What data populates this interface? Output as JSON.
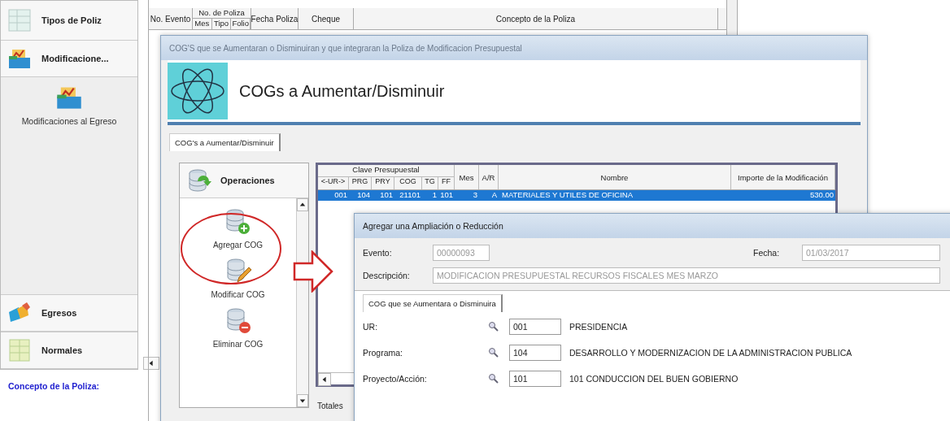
{
  "nav": {
    "items": [
      {
        "label": "Tipos de Poliz"
      },
      {
        "label": "Modificacione..."
      }
    ],
    "sub_item": {
      "label": "Modificaciones al Egreso"
    },
    "bottom_items": [
      {
        "label": "Egresos"
      },
      {
        "label": "Normales"
      }
    ]
  },
  "concept": {
    "label": "Concepto de la Poliza:"
  },
  "polizas_table": {
    "columns": [
      {
        "label": "No. Evento"
      },
      {
        "label": "No. de Poliza",
        "sub": [
          "Mes",
          "Tipo",
          "Folio"
        ]
      },
      {
        "label": "Fecha Poliza"
      },
      {
        "label": "Cheque"
      },
      {
        "label": "Concepto de la Poliza"
      }
    ]
  },
  "cogs_window": {
    "title": "COG'S que se Aumentaran o Disminuiran y que integraran la Poliza de Modificacion Presupuestal",
    "heading": "COGs a Aumentar/Disminuir",
    "tabs": [
      {
        "label": "COG's a Aumentar/Disminuir",
        "selected": true
      }
    ],
    "operations": {
      "title": "Operaciones",
      "items": [
        {
          "label": "Agregar COG"
        },
        {
          "label": "Modificar COG"
        },
        {
          "label": "Eliminar COG"
        }
      ]
    },
    "table": {
      "group": "Clave Presupuestal",
      "columns": [
        "<-UR->",
        "PRG",
        "PRY",
        "COG",
        "TG",
        "FF",
        "Mes",
        "A/R",
        "Nombre",
        "Importe de la Modificación"
      ],
      "rows": [
        {
          "cells": [
            "001",
            "104",
            "101",
            "21101",
            "1",
            "101",
            "3",
            "A",
            "MATERIALES Y UTILES DE OFICINA",
            "530.00"
          ],
          "selected": true
        }
      ]
    },
    "totals_label": "Totales"
  },
  "add_window": {
    "title": "Agregar una Ampliación o Reducción",
    "evento": {
      "label": "Evento:",
      "value": "00000093",
      "disabled": true
    },
    "fecha": {
      "label": "Fecha:",
      "value": "01/03/2017",
      "disabled": true
    },
    "descripcion": {
      "label": "Descripción:",
      "value": "MODIFICACION PRESUPUESTAL RECURSOS FISCALES MES MARZO",
      "disabled": true
    },
    "tabs": [
      {
        "label": "COG que se Aumentara o Disminuira",
        "selected": true
      }
    ],
    "rows": [
      {
        "label": "UR:",
        "code": "001",
        "name": "PRESIDENCIA"
      },
      {
        "label": "Programa:",
        "code": "104",
        "name": "DESARROLLO Y MODERNIZACION DE LA ADMINISTRACION PUBLICA"
      },
      {
        "label": "Proyecto/Acción:",
        "code": "101",
        "name": "101 CONDUCCION DEL BUEN GOBIERNO"
      }
    ]
  }
}
